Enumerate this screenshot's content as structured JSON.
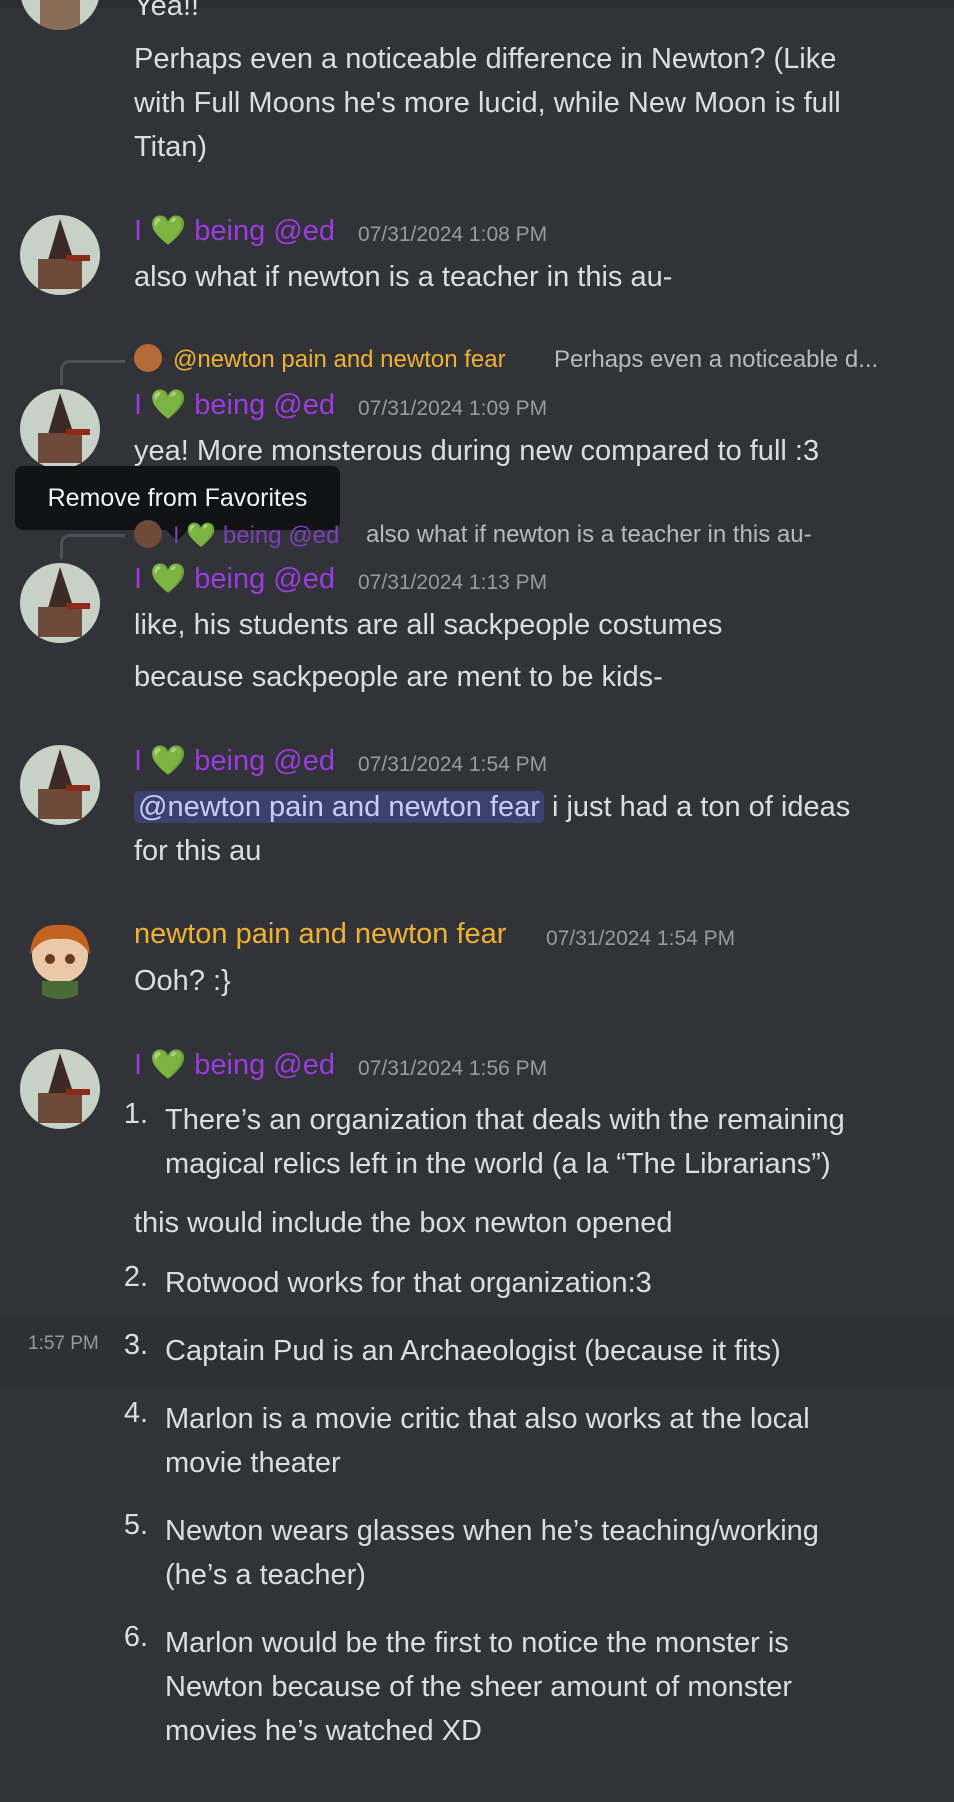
{
  "messages": {
    "top_partial": "Yea!!",
    "m0": "Perhaps even a noticeable difference in Newton? (Like with Full Moons he's more lucid, while New Moon is full Titan)",
    "m1": {
      "author": "I 💚 being @ed",
      "time": "07/31/2024 1:08 PM",
      "text": "also what if newton is a teacher in this au-"
    },
    "m2": {
      "reply_author": "@newton pain and newton fear",
      "reply_text": "Perhaps even a noticeable d...",
      "author": "I 💚 being @ed",
      "time": "07/31/2024 1:09 PM",
      "text": "yea! More monsterous during new compared to full :3"
    },
    "m3": {
      "reply_author": "I 💚 being @ed",
      "reply_text": "also what if newton is a teacher in this au-",
      "author": "I 💚 being @ed",
      "time": "07/31/2024 1:13 PM",
      "text1": "like, his students are all sackpeople costumes",
      "text2": "because sackpeople are ment to be kids-"
    },
    "m4": {
      "author": "I 💚 being @ed",
      "time": "07/31/2024 1:54 PM",
      "mention": "@newton pain and newton fear",
      "text_after": " i just had a ton of ideas",
      "text_line2": "for this au"
    },
    "m5": {
      "author": "newton pain and newton fear",
      "time": "07/31/2024 1:54 PM",
      "text": "Ooh? :}"
    },
    "m6": {
      "author": "I 💚 being @ed",
      "time": "07/31/2024 1:56 PM",
      "item1": "There’s an organization that deals with the remaining magical relics left in the world (a la “The Librarians”)",
      "note": "this would include the box newton opened",
      "item2": "Rotwood works for that organization:3",
      "hover_time": "1:57 PM",
      "item3": "Captain Pud is an Archaeologist (because it fits)",
      "item4": "Marlon is a movie critic that also works at the local movie theater",
      "item5": "Newton wears glasses when he’s teaching/working (he’s a teacher)",
      "item6": "Marlon would be the first to notice the monster is Newton because of the sheer amount of monster movies he’s watched XD"
    }
  },
  "tooltip": {
    "label": "Remove from Favorites"
  },
  "colors": {
    "background": "#313338",
    "name_purple": "#9b3be0",
    "name_gold": "#f0b232",
    "mention_bg": "#3c4270"
  }
}
